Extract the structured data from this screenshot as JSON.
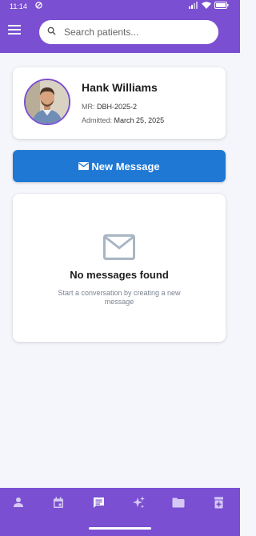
{
  "status_bar": {
    "time": "11:14"
  },
  "search": {
    "placeholder": "Search patients..."
  },
  "patient": {
    "name": "Hank Williams",
    "mr_label": "MR:",
    "mr_value": "DBH-2025-2",
    "admitted_label": "Admitted:",
    "admitted_value": "March 25, 2025"
  },
  "actions": {
    "new_message_label": "New Message"
  },
  "messages": {
    "empty_title": "No messages found",
    "empty_subtitle": "Start a conversation by creating a new message"
  },
  "nav": {
    "items": [
      {
        "icon": "person-icon",
        "active": false
      },
      {
        "icon": "calendar-icon",
        "active": false
      },
      {
        "icon": "chat-icon",
        "active": true
      },
      {
        "icon": "sparkle-icon",
        "active": false
      },
      {
        "icon": "folder-icon",
        "active": false
      },
      {
        "icon": "medical-box-icon",
        "active": false
      }
    ]
  },
  "colors": {
    "brand": "#7a4fd1",
    "primary_button": "#1e78d4",
    "background": "#f4f6fb",
    "nav_inactive": "#d6c8f5"
  }
}
